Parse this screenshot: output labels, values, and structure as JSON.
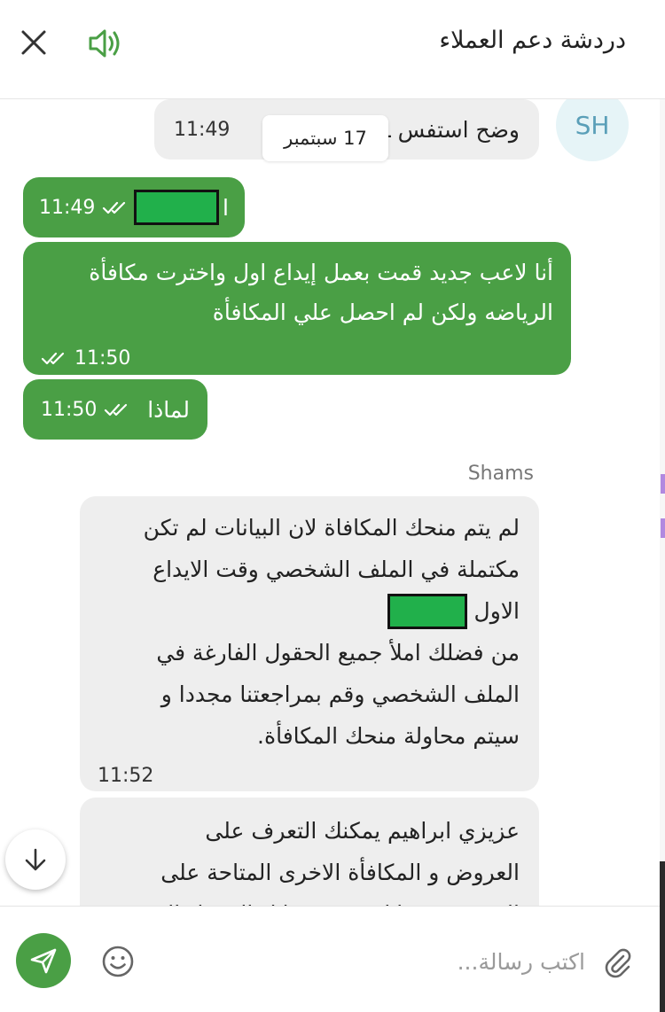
{
  "header": {
    "title": "دردشة دعم العملاء"
  },
  "colors": {
    "accent": "#4a9f45",
    "incoming_bubble": "#eeeeee",
    "avatar_bg": "#e6f4f7",
    "avatar_text": "#5a9fb8"
  },
  "chat": {
    "avatar_initials": "SH",
    "date_chip": "17 سبتمبر",
    "messages": [
      {
        "direction": "in",
        "text": "وضح استفس  ـك",
        "time": "11:49"
      },
      {
        "direction": "out",
        "text": "ا",
        "time": "11:49",
        "redacted": true
      },
      {
        "direction": "out",
        "lines": [
          "أنا لاعب جديد قمت بعمل إيداع اول واخترت مكافأة",
          "الرياضه ولكن لم احصل علي المكافأة"
        ],
        "time": "11:50"
      },
      {
        "direction": "out",
        "text": "لماذا",
        "time": "11:50"
      },
      {
        "direction": "in",
        "sender": "Shams",
        "lines": [
          "لم يتم منحك المكافاة لان البيانات لم تكن",
          "مكتملة في الملف الشخصي وقت الايداع",
          "الاول",
          "من فضلك املأ جميع الحقول الفارغة في",
          "الملف الشخصي وقم بمراجعتنا مجددا و",
          "سيتم محاولة منحك المكافأة."
        ],
        "time": "11:52"
      },
      {
        "direction": "in",
        "lines": [
          "عزيزي ابراهيم  يمكنك التعرف على",
          "العروض و المكافأة الاخرى المتاحة على",
          "الموقع من خلال ... من خلال الدخول الى"
        ]
      }
    ]
  },
  "composer": {
    "placeholder": "اكتب رسالة..."
  }
}
